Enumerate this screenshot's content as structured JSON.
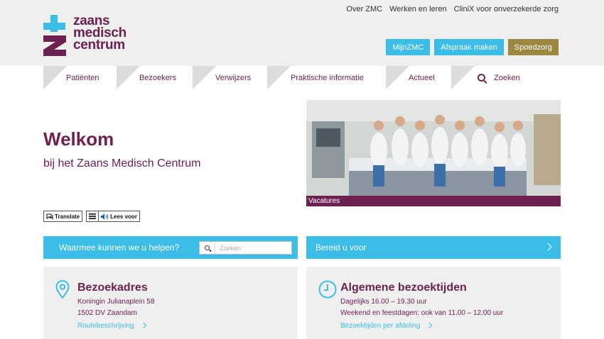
{
  "top_links": [
    "Over ZMC",
    "Werken en leren",
    "CliniX voor onverzekerde zorg"
  ],
  "logo": {
    "line1": "zaans",
    "line2": "medisch",
    "line3": "centrum"
  },
  "header_buttons": {
    "mijnzmc": "MijnZMC",
    "afspraak": "Afspraak maken",
    "spoedzorg": "Spoedzorg"
  },
  "nav": {
    "items": [
      "Patiënten",
      "Bezoekers",
      "Verwijzers",
      "Praktische informatie",
      "Actueel"
    ],
    "search_label": "Zoeken"
  },
  "welcome": {
    "title": "Welkom",
    "subtitle": "bij het Zaans Medisch Centrum"
  },
  "hero": {
    "caption": "Vacatures"
  },
  "tools": {
    "translate": "Translate",
    "lees_voor": "Lees voor"
  },
  "help": {
    "label": "Waarmee kunnen we u helpen?",
    "search_placeholder": "Zoeken"
  },
  "bereid": {
    "label": "Bereid u voor"
  },
  "address_card": {
    "title": "Bezoekadres",
    "line1": "Koningin Julianaplein 58",
    "line2": "1502 DV Zaandam",
    "link": "Routebeschrijving"
  },
  "hours_card": {
    "title": "Algemene bezoektijden",
    "line1": "Dagelijks 16.00 – 19.30 uur",
    "line2": "Weekend en feestdagen: ook van 11.00 – 12.00 uur",
    "link": "Bezoektijden per afdeling"
  },
  "colors": {
    "primary_purple": "#6d2150",
    "accent_blue": "#3cbde8",
    "spoed_gold": "#9b8740",
    "header_gray": "#efefef"
  },
  "icons": {
    "search": "search-icon",
    "location": "location-pin-icon",
    "clock": "clock-icon",
    "chevron": "chevron-right-icon",
    "speaker": "speaker-icon",
    "menu": "menu-icon",
    "chat": "chat-icon"
  }
}
